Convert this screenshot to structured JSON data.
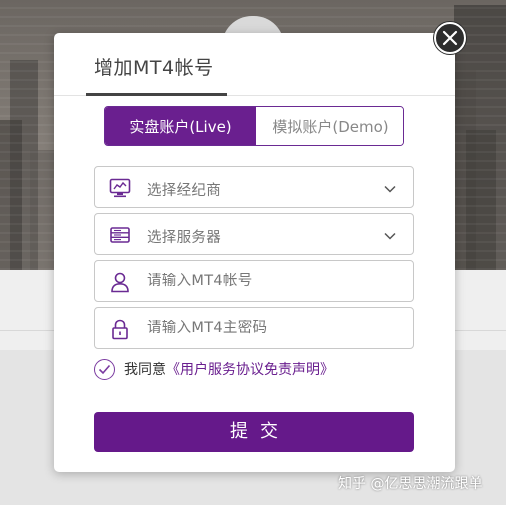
{
  "modal": {
    "title": "增加MT4帐号",
    "tabs": {
      "live_label": "实盘账户(Live)",
      "demo_label": "模拟账户(Demo)",
      "selected": "live"
    },
    "fields": {
      "broker_label": "选择经纪商",
      "server_label": "选择服务器",
      "account_placeholder": "请输入MT4帐号",
      "password_placeholder": "请输入MT4主密码"
    },
    "agreement": {
      "checked": true,
      "prefix": "我同意",
      "link_text": "《用户服务协议免责声明》"
    },
    "submit_label": "提交"
  },
  "watermark": "知乎 @亿思思潮流跟单",
  "icons": {
    "close": "close-icon",
    "broker": "broker-monitor-icon",
    "server": "server-icon",
    "account": "user-icon",
    "password": "lock-icon",
    "dropdown": "chevron-down-icon",
    "check": "checkmark-icon"
  },
  "colors": {
    "accent": "#6a1f8f",
    "submit": "#65198a",
    "text_muted": "#777777",
    "title": "#444444"
  }
}
